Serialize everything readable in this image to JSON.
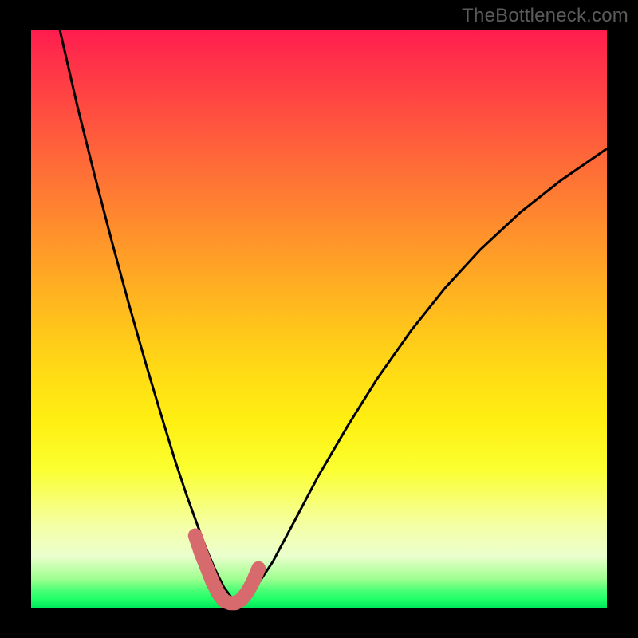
{
  "watermark": "TheBottleneck.com",
  "colors": {
    "frame": "#000000",
    "curve": "#000000",
    "highlight": "#d76a6d",
    "gradient_top": "#ff1c4f",
    "gradient_bottom": "#00e85b"
  },
  "chart_data": {
    "type": "line",
    "title": "",
    "xlabel": "",
    "ylabel": "",
    "xlim": [
      0,
      100
    ],
    "ylim": [
      0,
      100
    ],
    "grid": false,
    "legend": false,
    "annotations": [],
    "series": [
      {
        "name": "main-curve",
        "color": "#000000",
        "x": [
          5,
          8,
          11,
          14,
          17,
          20,
          23,
          25,
          27,
          29,
          30.5,
          32,
          33.5,
          35,
          37,
          39,
          42,
          46,
          50,
          55,
          60,
          66,
          72,
          78,
          85,
          92,
          100
        ],
        "y": [
          100,
          87,
          75,
          63.5,
          52.5,
          42,
          32,
          25.5,
          19.5,
          14,
          10,
          6.5,
          3.5,
          1.5,
          1.5,
          3.5,
          8,
          15.5,
          23,
          31.5,
          39.5,
          48,
          55.5,
          62,
          68.5,
          74,
          79.5
        ]
      },
      {
        "name": "highlight-bottom",
        "color": "#d76a6d",
        "x": [
          28.5,
          29.5,
          30.5,
          31.5,
          32.5,
          33.5,
          34.5,
          35.5,
          36.5,
          37.5,
          38.5,
          39.5
        ],
        "y": [
          12.5,
          9.5,
          7,
          4.5,
          2.5,
          1.2,
          0.8,
          0.8,
          1.4,
          2.6,
          4.4,
          6.8
        ]
      }
    ]
  }
}
